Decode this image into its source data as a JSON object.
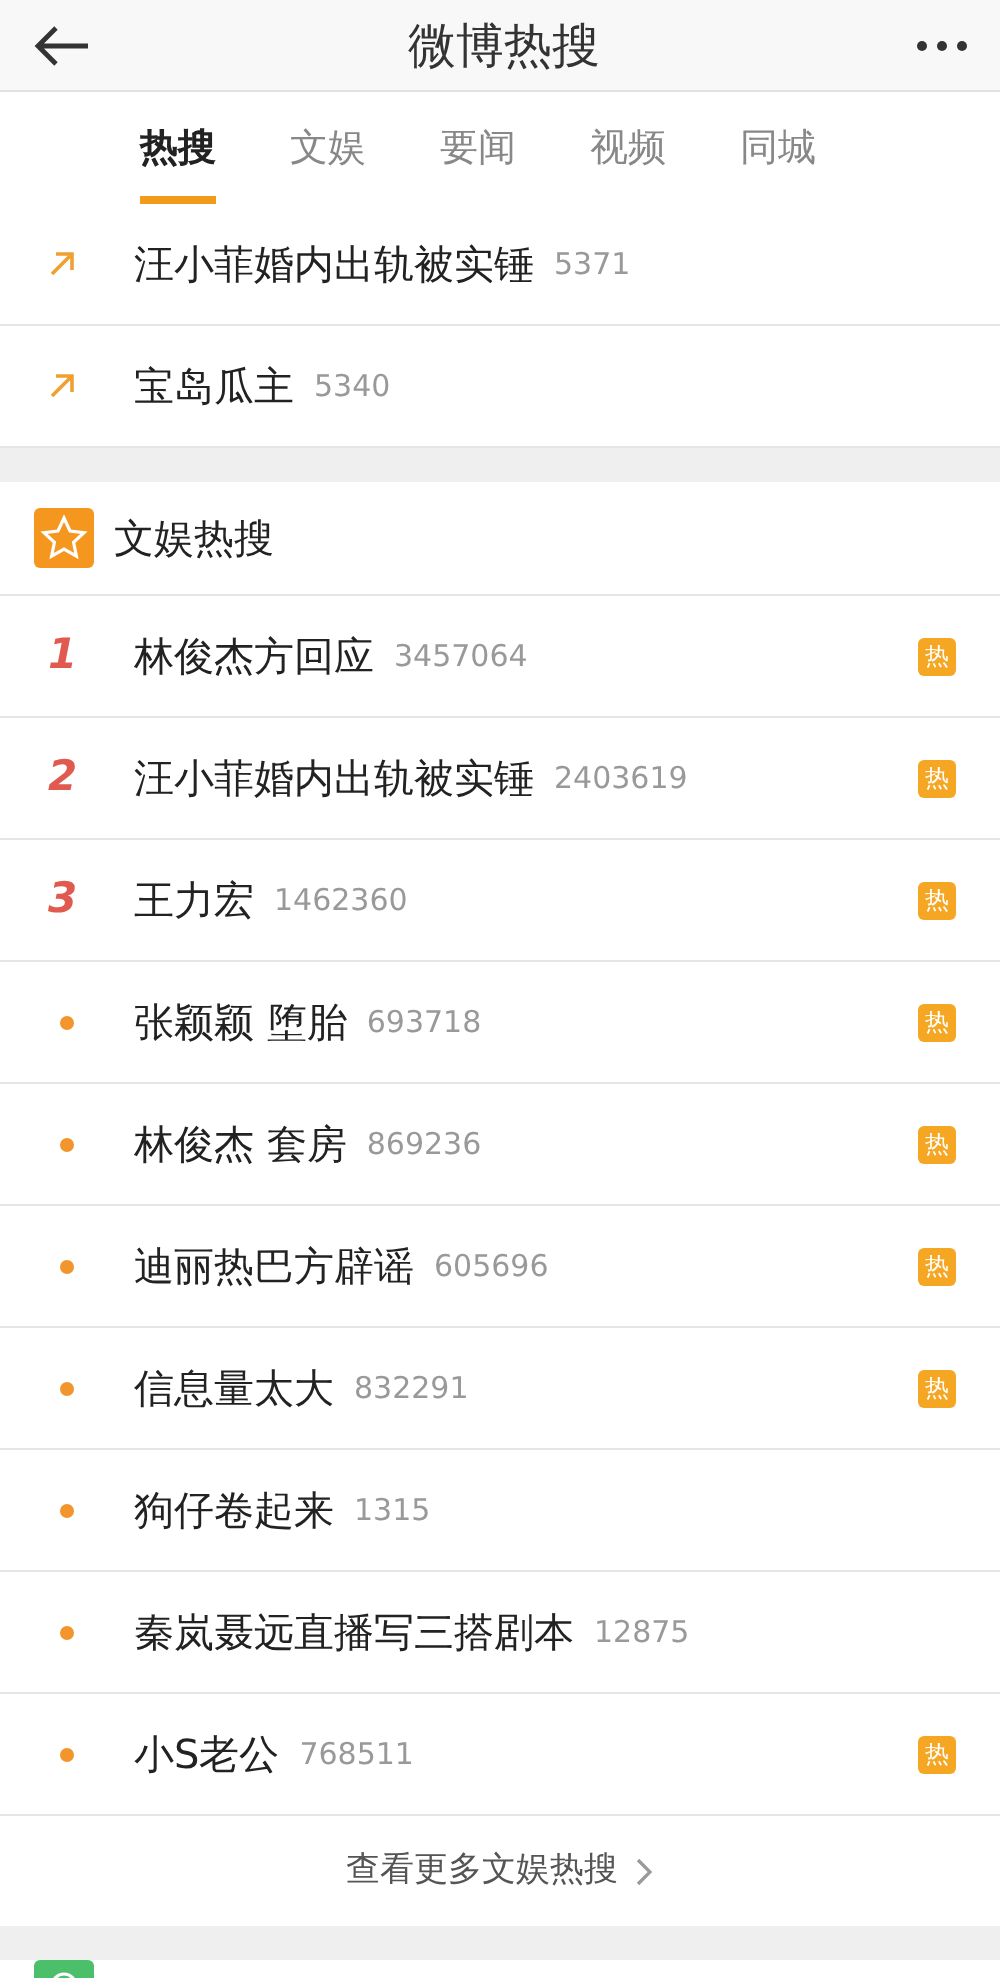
{
  "header": {
    "title": "微博热搜"
  },
  "tabs": [
    {
      "label": "热搜",
      "selected": true
    },
    {
      "label": "文娱",
      "selected": false
    },
    {
      "label": "要闻",
      "selected": false
    },
    {
      "label": "视频",
      "selected": false
    },
    {
      "label": "同城",
      "selected": false
    }
  ],
  "top_rows": [
    {
      "kind": "rising",
      "title": "汪小菲婚内出轨被实锤",
      "count": "5371"
    },
    {
      "kind": "rising",
      "title": "宝岛瓜主",
      "count": "5340"
    }
  ],
  "section": {
    "title": "文娱热搜",
    "rows": [
      {
        "kind": "rank",
        "rank": "1",
        "title": "林俊杰方回应",
        "count": "3457064",
        "badge": "热"
      },
      {
        "kind": "rank",
        "rank": "2",
        "title": "汪小菲婚内出轨被实锤",
        "count": "2403619",
        "badge": "热"
      },
      {
        "kind": "rank",
        "rank": "3",
        "title": "王力宏",
        "count": "1462360",
        "badge": "热"
      },
      {
        "kind": "dot",
        "title": "张颖颖 堕胎",
        "count": "693718",
        "badge": "热"
      },
      {
        "kind": "dot",
        "title": "林俊杰 套房",
        "count": "869236",
        "badge": "热"
      },
      {
        "kind": "dot",
        "title": "迪丽热巴方辟谣",
        "count": "605696",
        "badge": "热"
      },
      {
        "kind": "dot",
        "title": "信息量太大",
        "count": "832291",
        "badge": "热"
      },
      {
        "kind": "dot",
        "title": "狗仔卷起来",
        "count": "1315"
      },
      {
        "kind": "dot",
        "title": "秦岚聂远直播写三搭剧本",
        "count": "12875"
      },
      {
        "kind": "dot",
        "title": "小S老公",
        "count": "768511",
        "badge": "热"
      }
    ],
    "more_link": "查看更多文娱热搜"
  }
}
